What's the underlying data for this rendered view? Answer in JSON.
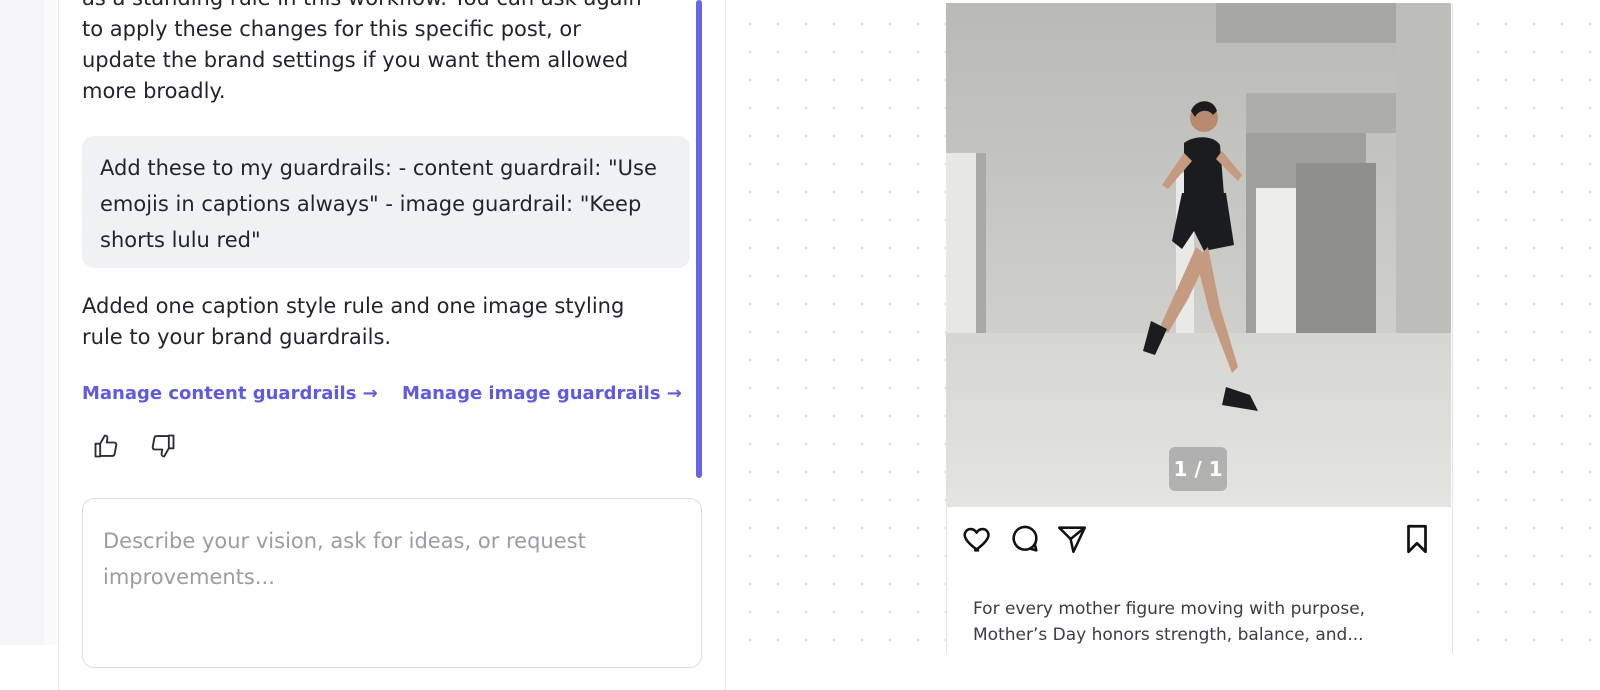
{
  "chat": {
    "assistant_message_1": "as a standing rule in this workflow. You can ask again to apply these changes for this specific post, or update the brand settings if you want them allowed more broadly.",
    "user_message": "Add these to my guardrails: - content guardrail: \"Use emojis in captions always\" - image guardrail: \"Keep shorts lulu red\"",
    "assistant_message_2": "Added one caption style rule and one image styling rule to your brand guardrails.",
    "links": {
      "content": "Manage content guardrails →",
      "image": "Manage image guardrails →"
    },
    "feedback": {
      "up_icon": "thumbs-up-icon",
      "down_icon": "thumbs-down-icon"
    },
    "composer_placeholder": "Describe your vision, ask for ideas, or request improvements..."
  },
  "post": {
    "image_counter": "1 / 1",
    "icons": [
      "heart-icon",
      "comment-icon",
      "send-icon",
      "bookmark-icon"
    ],
    "caption": "For every mother figure moving with purpose, Mother’s Day honors strength, balance, and..."
  },
  "colors": {
    "accent": "#6a63e6",
    "link": "#5f5ae0",
    "bubble": "#f0f1f5"
  }
}
